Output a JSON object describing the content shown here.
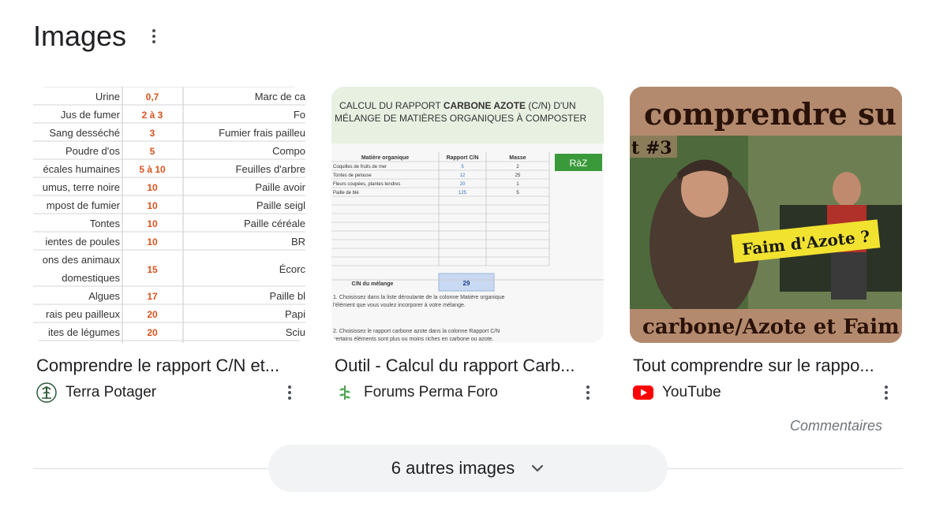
{
  "header": {
    "title": "Images",
    "menu_icon": "more-vert-icon"
  },
  "cards": [
    {
      "title": "Comprendre le rapport C/N et...",
      "source": "Terra Potager",
      "favicon": "terra-potager-logo",
      "thumbnail": {
        "rows": [
          {
            "left": "Urine",
            "value": "0,7",
            "right": "Marc de ca"
          },
          {
            "left": "Jus de fumer",
            "value": "2 à 3",
            "right": "Fo"
          },
          {
            "left": "Sang desséché",
            "value": "3",
            "right": "Fumier frais pailleu"
          },
          {
            "left": "Poudre d'os",
            "value": "5",
            "right": "Compo"
          },
          {
            "left": "écales humaines",
            "value": "5 à 10",
            "right": "Feuilles d'arbre"
          },
          {
            "left": "umus, terre noire",
            "value": "10",
            "right": "Paille avoir"
          },
          {
            "left": "mpost de fumier",
            "value": "10",
            "right": "Paille seigl"
          },
          {
            "left": "Tontes",
            "value": "10",
            "right": "Paille céréale"
          },
          {
            "left": "ientes de poules",
            "value": "10",
            "right": "BR"
          },
          {
            "left": "ons des animaux",
            "value": "15",
            "right": "Écorc"
          },
          {
            "left": "domestiques",
            "value": "",
            "right": ""
          },
          {
            "left": "Algues",
            "value": "17",
            "right": "Paille bl"
          },
          {
            "left": "rais peu pailleux",
            "value": "20",
            "right": "Papi"
          },
          {
            "left": "ites de légumes",
            "value": "20",
            "right": "Sciu"
          }
        ]
      }
    },
    {
      "title": "Outil - Calcul du rapport Carb...",
      "source": "Forums Perma Foro",
      "favicon": "leaf-icon",
      "thumbnail": {
        "heading_part1": "CALCUL DU RAPPORT ",
        "heading_bold": "CARBONE AZOTE",
        "heading_part2": " (C/N) D'UN",
        "heading_line2": "MÉLANGE DE MATIÈRES ORGANIQUES À COMPOSTER",
        "col_headers": [
          "Matière organique",
          "Rapport C/N",
          "Masse"
        ],
        "button": "RàZ",
        "rows": [
          [
            "Coquilles de fruits de mer",
            "5",
            "2"
          ],
          [
            "Tontes de pelouse",
            "12",
            "25"
          ],
          [
            "Fleurs coupées, plantes tendres",
            "20",
            "1"
          ],
          [
            "Paille de blé",
            "125",
            "5"
          ]
        ],
        "result_label": "C/N du mélange",
        "result_value": "29",
        "note1": "1. Choisissez dans la liste déroulante de la colonne Matière organique",
        "note1b": "l'élément que vous voulez incorporer à votre mélange.",
        "note2": "2. Choisissez le rapport carbone azote dans la colonne Rapport C/N",
        "note2b": "certains éléments sont plus ou moins riches en carbone ou azote."
      }
    },
    {
      "title": "Tout comprendre sur le rappo...",
      "source": "YouTube",
      "favicon": "youtube-icon",
      "thumbnail": {
        "top_text": "comprendre su",
        "episode": "t #3",
        "badge": "Faim d'Azote ?",
        "bottom_text": "carbone/Azote et Faim"
      }
    }
  ],
  "feedback": "Commentaires",
  "more_button": {
    "label": "6 autres images",
    "icon": "chevron-down-icon"
  },
  "colors": {
    "text": "#202124",
    "secondary": "#70757a",
    "chip_bg": "#f1f3f4",
    "youtube_red": "#ff0000",
    "calc_green": "#3a9a3a"
  }
}
